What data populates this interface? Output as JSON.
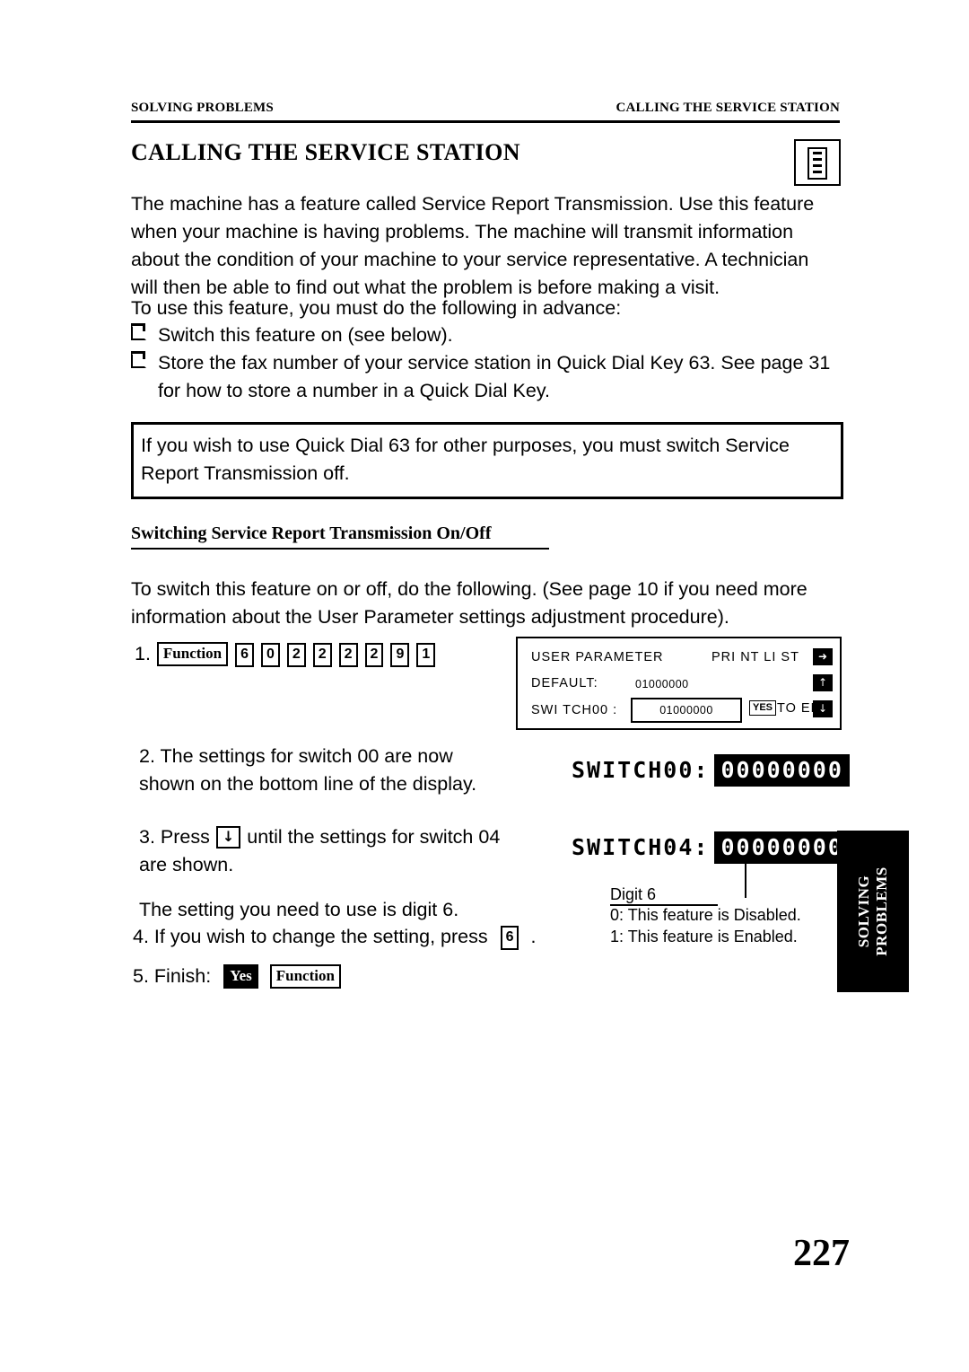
{
  "runhead": {
    "left": "SOLVING PROBLEMS",
    "right": "CALLING THE SERVICE STATION"
  },
  "title": "CALLING THE SERVICE STATION",
  "paragraphs": {
    "p1": "The machine has a feature called Service Report Transmission. Use this feature when your machine is having problems. The machine will transmit information about the condition of your machine to your service representative. A technician will then be able to find out what the problem is before making a visit.",
    "p2": "To use this feature, you must do the following in advance:",
    "bullet1": "Switch this feature on (see below).",
    "bullet2": "Store the fax number of your service station in Quick Dial Key 63. See page 31 for how to store a number in a Quick Dial Key.",
    "note": "If you wish to use Quick Dial 63 for other purposes, you must switch Service Report Transmission off.",
    "subhead": "Switching Service Report Transmission On/Off",
    "p3": "To switch this feature on or off, do the following. (See page 10 if you need more information about the User Parameter settings adjustment procedure)."
  },
  "steps": {
    "s1_num": "1.",
    "s1_keys": [
      "Function",
      "6",
      "0",
      "2",
      "2",
      "2",
      "2",
      "9",
      "1"
    ],
    "s2": "2.  The settings for switch 00 are now shown on the bottom line of the display.",
    "s3_a": "3. Press",
    "s3_key": "↓",
    "s3_b": "until the settings for switch 04 are shown.",
    "s3_c": "The setting you need to use is digit 6.",
    "s4_a": "4. If you wish to change the setting, press",
    "s4_key": "6",
    "s4_b": ".",
    "s5_label": "5. Finish:",
    "s5_key1": "Yes",
    "s5_key2": "Function"
  },
  "lcd": {
    "line1_left": "USER PARAMETER",
    "line1_right": "PRI NT LI ST",
    "line2_left": "DEFAULT:",
    "line2_value": "01000000",
    "line3_left": "SWI TCH00 :",
    "line3_value": "01000000",
    "yes_key": "YES",
    "to_end": "TO END",
    "btn1": "➜",
    "btn2": "↑",
    "btn3": "↓"
  },
  "switch_displays": {
    "s00_label": "SWITCH00:",
    "s00_value": "00000000",
    "s04_label": "SWITCH04:",
    "s04_value": "00000000"
  },
  "callout": {
    "digit_label": "Digit 6",
    "desc0": "0: This feature is Disabled.",
    "desc1": "1: This feature is Enabled."
  },
  "side_tab": "SOLVING PROBLEMS",
  "page_number": "227"
}
